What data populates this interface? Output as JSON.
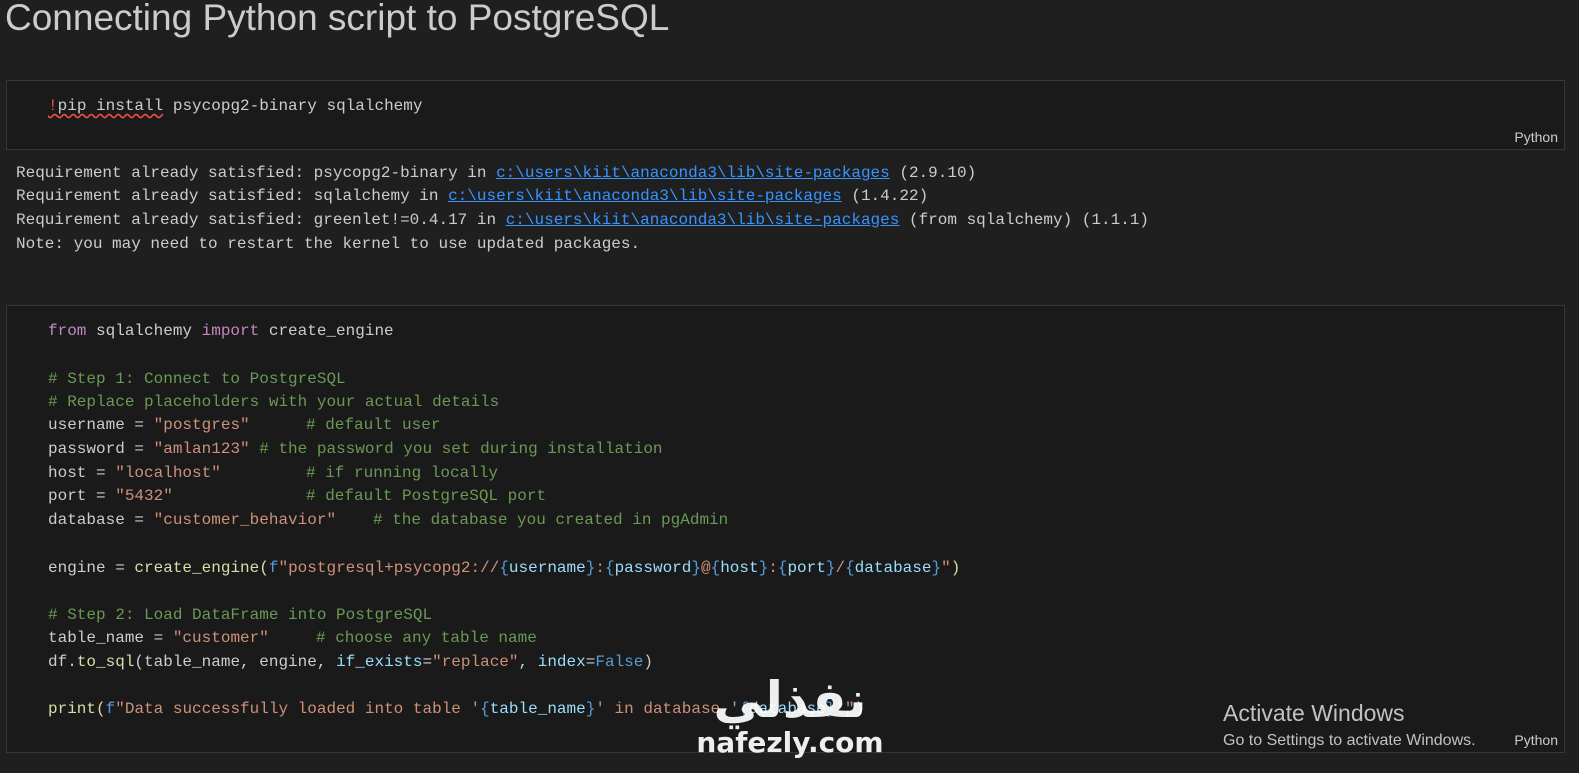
{
  "page": {
    "title": "Connecting Python script to PostgreSQL"
  },
  "cell1": {
    "code": {
      "bang": "!",
      "pip": "pip install",
      "rest": " psycopg2-binary sqlalchemy"
    },
    "language": "Python",
    "output": [
      {
        "pre": "Requirement already satisfied: psycopg2-binary in ",
        "link": "c:\\users\\kiit\\anaconda3\\lib\\site-packages",
        "post": " (2.9.10)"
      },
      {
        "pre": "Requirement already satisfied: sqlalchemy in ",
        "link": "c:\\users\\kiit\\anaconda3\\lib\\site-packages",
        "post": " (1.4.22)"
      },
      {
        "pre": "Requirement already satisfied: greenlet!=0.4.17 in ",
        "link": "c:\\users\\kiit\\anaconda3\\lib\\site-packages",
        "post": " (from sqlalchemy) (1.1.1)"
      },
      {
        "pre": "Note: you may need to restart the kernel to use updated packages.",
        "link": "",
        "post": ""
      }
    ]
  },
  "cell2": {
    "language": "Python",
    "l1": {
      "from": "from",
      "mod": " sqlalchemy ",
      "import": "import",
      "name": " create_engine"
    },
    "c1": "# Step 1: Connect to PostgreSQL",
    "c2": "# Replace placeholders with your actual details",
    "l_user": {
      "name": "username = ",
      "val": "\"postgres\"",
      "cmt": "# default user"
    },
    "l_pass": {
      "name": "password = ",
      "val": "\"amlan123\"",
      "cmt": "# the password you set during installation"
    },
    "l_host": {
      "name": "host = ",
      "val": "\"localhost\"",
      "cmt": "# if running locally"
    },
    "l_port": {
      "name": "port = ",
      "val": "\"5432\"",
      "cmt": "# default PostgreSQL port"
    },
    "l_db": {
      "name": "database = ",
      "val": "\"customer_behavior\"",
      "cmt": "# the database you created in pgAdmin"
    },
    "l_engine": {
      "a": "engine = ",
      "fn": "create_engine",
      "p1": "(",
      "f": "f",
      "s1": "\"postgresql+psycopg2://",
      "v1": "username",
      "s2": ":",
      "v2": "password",
      "s3": "@",
      "v3": "host",
      "s4": ":",
      "v4": "port",
      "s5": "/",
      "v5": "database",
      "s6": "\"",
      "p2": ")"
    },
    "c3": "# Step 2: Load DataFrame into PostgreSQL",
    "l_table": {
      "name": "table_name = ",
      "val": "\"customer\"",
      "cmt": "# choose any table name"
    },
    "l_tosql": {
      "a": "df.",
      "fn": "to_sql",
      "b": "(table_name, engine, ",
      "k1": "if_exists",
      "eq": "=",
      "s": "\"replace\"",
      "c": ", ",
      "k2": "index",
      "eq2": "=",
      "f": "False",
      "e": ")"
    },
    "l_print": {
      "fn": "print",
      "p1": "(",
      "f": "f",
      "s1": "\"Data successfully loaded into table '",
      "v1": "table_name",
      "s2": "' in database '",
      "v2": "database",
      "s3": "'\"",
      "p2": ")"
    }
  },
  "overlay": {
    "activate_title": "Activate Windows",
    "activate_sub": "Go to Settings to activate Windows.",
    "watermark_ar": "نفذلي",
    "watermark_en": "nafezly.com"
  }
}
